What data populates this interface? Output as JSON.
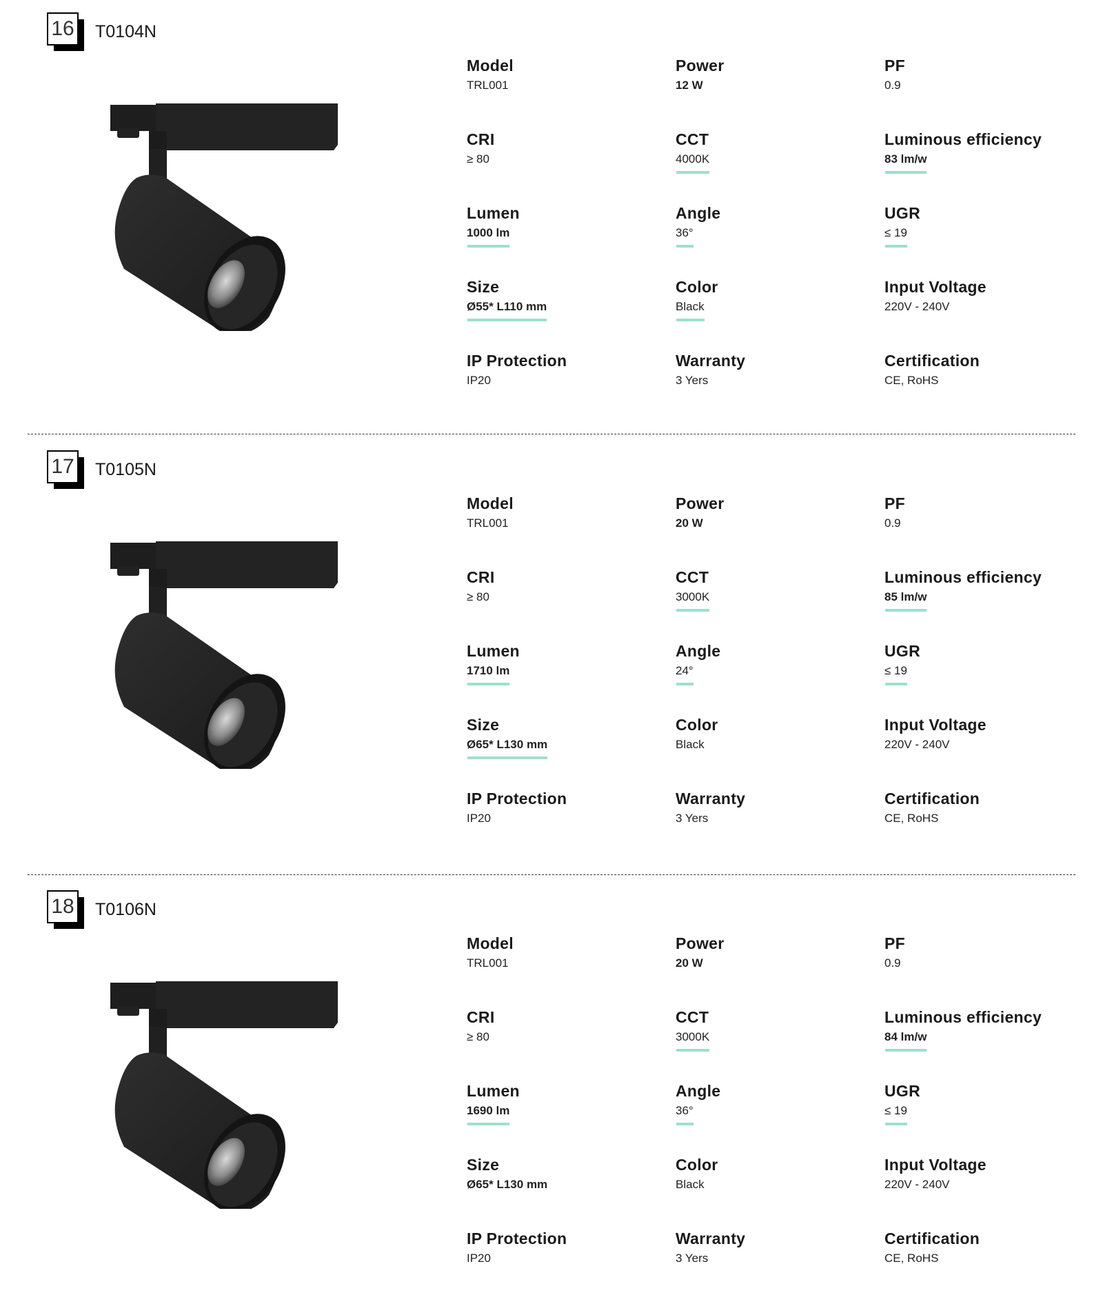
{
  "accent_color": "#9de0cd",
  "products": [
    {
      "index": "16",
      "code": "T0104N",
      "image_alt": "black-track-spotlight",
      "specs": [
        {
          "label": "Model",
          "value": "TRL001",
          "bold": false,
          "underline": false
        },
        {
          "label": "Power",
          "value": "12 W",
          "bold": true,
          "underline": false
        },
        {
          "label": "PF",
          "value": "0.9",
          "bold": false,
          "underline": false
        },
        {
          "label": "CRI",
          "value": "≥ 80",
          "bold": false,
          "underline": false
        },
        {
          "label": "CCT",
          "value": "4000K",
          "bold": false,
          "underline": true
        },
        {
          "label": "Luminous efficiency",
          "value": "83 lm/w",
          "bold": true,
          "underline": true
        },
        {
          "label": "Lumen",
          "value": "1000 lm",
          "bold": true,
          "underline": true
        },
        {
          "label": "Angle",
          "value": "36°",
          "bold": false,
          "underline": true
        },
        {
          "label": "UGR",
          "value": "≤ 19",
          "bold": false,
          "underline": true
        },
        {
          "label": "Size",
          "value": "Ø55* L110 mm",
          "bold": true,
          "underline": true
        },
        {
          "label": "Color",
          "value": "Black",
          "bold": false,
          "underline": true
        },
        {
          "label": "Input Voltage",
          "value": "220V - 240V",
          "bold": false,
          "underline": false
        },
        {
          "label": "IP Protection",
          "value": "IP20",
          "bold": false,
          "underline": false
        },
        {
          "label": "Warranty",
          "value": "3 Yers",
          "bold": false,
          "underline": false
        },
        {
          "label": "Certification",
          "value": "CE, RoHS",
          "bold": false,
          "underline": false
        }
      ]
    },
    {
      "index": "17",
      "code": "T0105N",
      "image_alt": "black-track-spotlight",
      "specs": [
        {
          "label": "Model",
          "value": "TRL001",
          "bold": false,
          "underline": false
        },
        {
          "label": "Power",
          "value": "20 W",
          "bold": true,
          "underline": false
        },
        {
          "label": "PF",
          "value": "0.9",
          "bold": false,
          "underline": false
        },
        {
          "label": "CRI",
          "value": "≥ 80",
          "bold": false,
          "underline": false
        },
        {
          "label": "CCT",
          "value": "3000K",
          "bold": false,
          "underline": true
        },
        {
          "label": "Luminous efficiency",
          "value": "85 lm/w",
          "bold": true,
          "underline": true
        },
        {
          "label": "Lumen",
          "value": "1710 lm",
          "bold": true,
          "underline": true
        },
        {
          "label": "Angle",
          "value": "24°",
          "bold": false,
          "underline": true
        },
        {
          "label": "UGR",
          "value": "≤ 19",
          "bold": false,
          "underline": true
        },
        {
          "label": "Size",
          "value": "Ø65* L130 mm",
          "bold": true,
          "underline": true
        },
        {
          "label": "Color",
          "value": "Black",
          "bold": false,
          "underline": false
        },
        {
          "label": "Input Voltage",
          "value": "220V - 240V",
          "bold": false,
          "underline": false
        },
        {
          "label": "IP Protection",
          "value": "IP20",
          "bold": false,
          "underline": false
        },
        {
          "label": "Warranty",
          "value": "3 Yers",
          "bold": false,
          "underline": false
        },
        {
          "label": "Certification",
          "value": "CE, RoHS",
          "bold": false,
          "underline": false
        }
      ]
    },
    {
      "index": "18",
      "code": "T0106N",
      "image_alt": "black-track-spotlight",
      "specs": [
        {
          "label": "Model",
          "value": "TRL001",
          "bold": false,
          "underline": false
        },
        {
          "label": "Power",
          "value": "20 W",
          "bold": true,
          "underline": false
        },
        {
          "label": "PF",
          "value": "0.9",
          "bold": false,
          "underline": false
        },
        {
          "label": "CRI",
          "value": "≥ 80",
          "bold": false,
          "underline": false
        },
        {
          "label": "CCT",
          "value": "3000K",
          "bold": false,
          "underline": true
        },
        {
          "label": "Luminous efficiency",
          "value": "84 lm/w",
          "bold": true,
          "underline": true
        },
        {
          "label": "Lumen",
          "value": "1690 lm",
          "bold": true,
          "underline": true
        },
        {
          "label": "Angle",
          "value": "36°",
          "bold": false,
          "underline": true
        },
        {
          "label": "UGR",
          "value": "≤ 19",
          "bold": false,
          "underline": true
        },
        {
          "label": "Size",
          "value": "Ø65* L130 mm",
          "bold": true,
          "underline": false
        },
        {
          "label": "Color",
          "value": "Black",
          "bold": false,
          "underline": false
        },
        {
          "label": "Input Voltage",
          "value": "220V - 240V",
          "bold": false,
          "underline": false
        },
        {
          "label": "IP Protection",
          "value": "IP20",
          "bold": false,
          "underline": false
        },
        {
          "label": "Warranty",
          "value": "3 Yers",
          "bold": false,
          "underline": false
        },
        {
          "label": "Certification",
          "value": "CE, RoHS",
          "bold": false,
          "underline": false
        }
      ]
    }
  ]
}
